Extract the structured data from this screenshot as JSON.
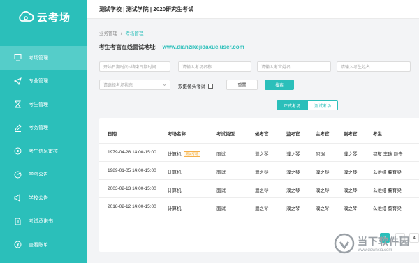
{
  "app": {
    "logo_text": "云考场"
  },
  "sidebar": {
    "items": [
      {
        "label": "考场管理",
        "icon": "monitor-icon",
        "active": true
      },
      {
        "label": "专业管理",
        "icon": "send-icon",
        "active": false
      },
      {
        "label": "考生管理",
        "icon": "hourglass-icon",
        "active": false
      },
      {
        "label": "考务管理",
        "icon": "pen-icon",
        "active": false
      },
      {
        "label": "考生信息审核",
        "icon": "target-icon",
        "active": false
      },
      {
        "label": "学院公告",
        "icon": "dial-icon",
        "active": false
      },
      {
        "label": "学校公告",
        "icon": "megaphone-icon",
        "active": false
      },
      {
        "label": "考试承诺书",
        "icon": "document-icon",
        "active": false
      },
      {
        "label": "查看账单",
        "icon": "yen-icon",
        "active": false
      }
    ]
  },
  "header": {
    "title": "测试学校 | 测试学院 | 2020研究生考试"
  },
  "breadcrumb": {
    "parent": "业务管理",
    "separator": "/",
    "current": "考场管理"
  },
  "url_line": {
    "label": "考生考官在线面试地址:",
    "url": "www.dianzikejidaxue.user.com"
  },
  "filters": {
    "date_range_placeholder": "开始日期时间~结束日期时间",
    "room_name_placeholder": "请输入考场名称",
    "examiner_placeholder": "请输入考官姓名",
    "student_placeholder": "请输入考生姓名",
    "status_placeholder": "请选择考场状态",
    "dual_camera_label": "双摄像头考试",
    "reset_label": "重置",
    "search_label": "搜索"
  },
  "tabs": [
    {
      "label": "正式考场",
      "active": true
    },
    {
      "label": "测试考场",
      "active": false
    }
  ],
  "table": {
    "headers": [
      "日期",
      "考场名称",
      "考试类型",
      "候考官",
      "监考官",
      "主考官",
      "副考官",
      "考生"
    ],
    "rows": [
      {
        "date": "1979-04-28",
        "time": "14:00-15:00",
        "name": "计算机",
        "tag": "测试考场",
        "type": "面试",
        "waiting": "濮之琴",
        "proctor": "濮之琴",
        "chief": "屈瑞",
        "deputy": "濮之琴",
        "students": "都友 丰瑞 颜舟"
      },
      {
        "date": "1989-01-05",
        "time": "14:00-15:00",
        "name": "计算机",
        "tag": "",
        "type": "面试",
        "waiting": "濮之琴",
        "proctor": "濮之琴",
        "chief": "濮之琴",
        "deputy": "濮之琴",
        "students": "么维绍 冀育梁"
      },
      {
        "date": "2003-02-13",
        "time": "14:00-15:00",
        "name": "计算机",
        "tag": "",
        "type": "面试",
        "waiting": "濮之琴",
        "proctor": "濮之琴",
        "chief": "濮之琴",
        "deputy": "濮之琴",
        "students": "么维绍 冀育梁"
      },
      {
        "date": "2018-02-12",
        "time": "14:00-15:00",
        "name": "计算机",
        "tag": "",
        "type": "面试",
        "waiting": "濮之琴",
        "proctor": "濮之琴",
        "chief": "濮之琴",
        "deputy": "濮之琴",
        "students": "么维绍 冀育梁"
      }
    ]
  },
  "pagination": {
    "pages": [
      "2",
      "3",
      "4"
    ],
    "active": "2"
  },
  "watermark": {
    "title": "当下软件园",
    "url": "www.downxia.com"
  },
  "colors": {
    "accent": "#2bbfba",
    "sidebar": "#2bbfba",
    "active_menu": "#55cdc9",
    "tag": "#f5a623"
  }
}
